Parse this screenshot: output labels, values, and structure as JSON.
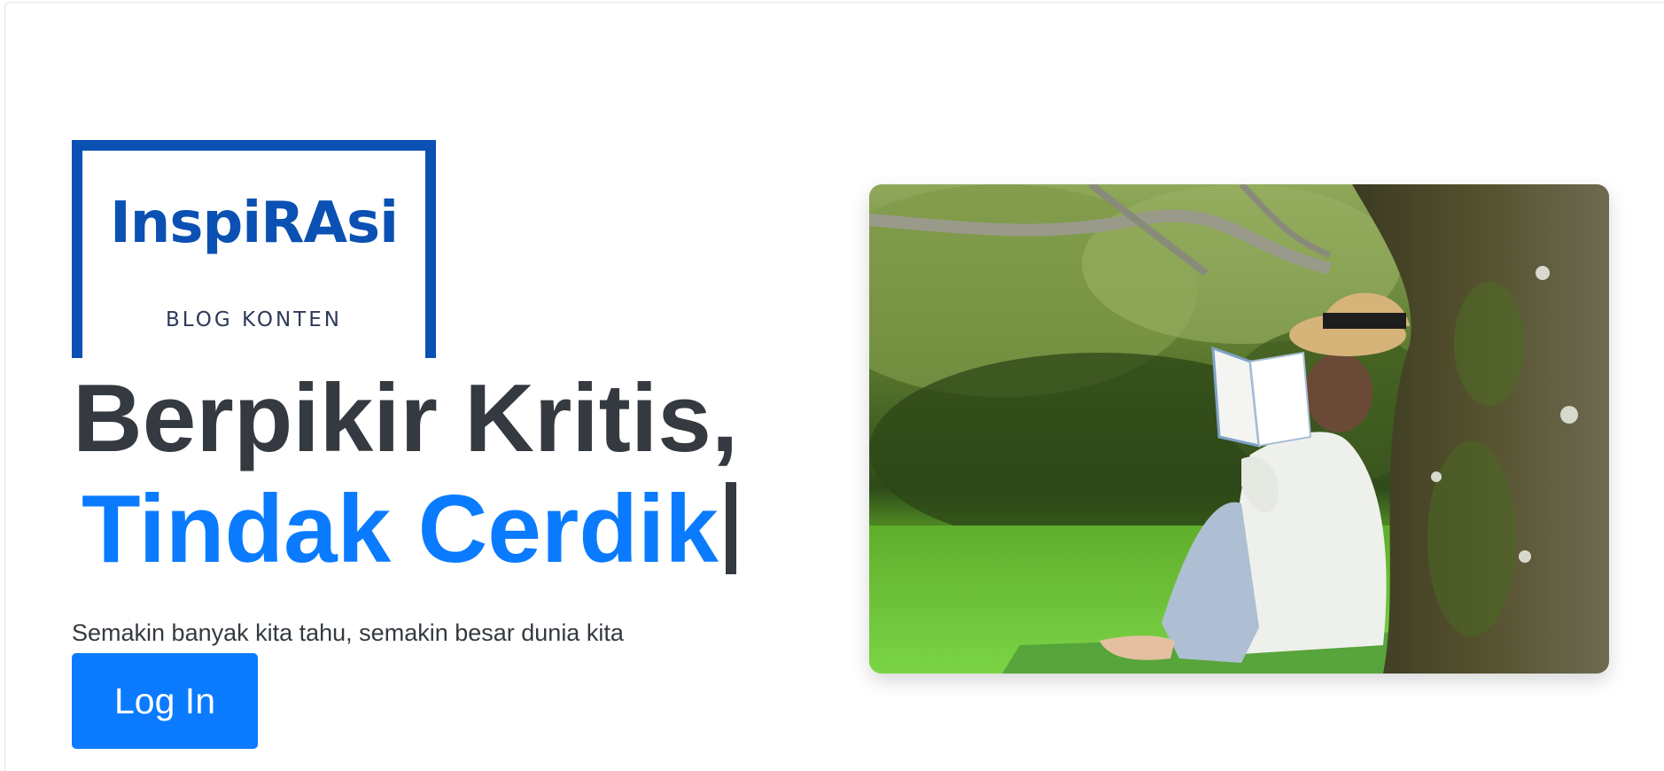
{
  "logo": {
    "title": "InspiRAsi",
    "subtitle": "BLOG KONTEN",
    "color": "#0b50b3"
  },
  "hero": {
    "headline_line1": "Berpikir Kritis,",
    "headline_line2": "Tindak Cerdik",
    "tagline": "Semakin banyak kita tahu, semakin besar dunia kita",
    "login_label": "Log In",
    "accent_color": "#0a7bff",
    "text_color": "#343a40"
  },
  "image": {
    "description_icon": "person-reading-under-tree-photo"
  }
}
